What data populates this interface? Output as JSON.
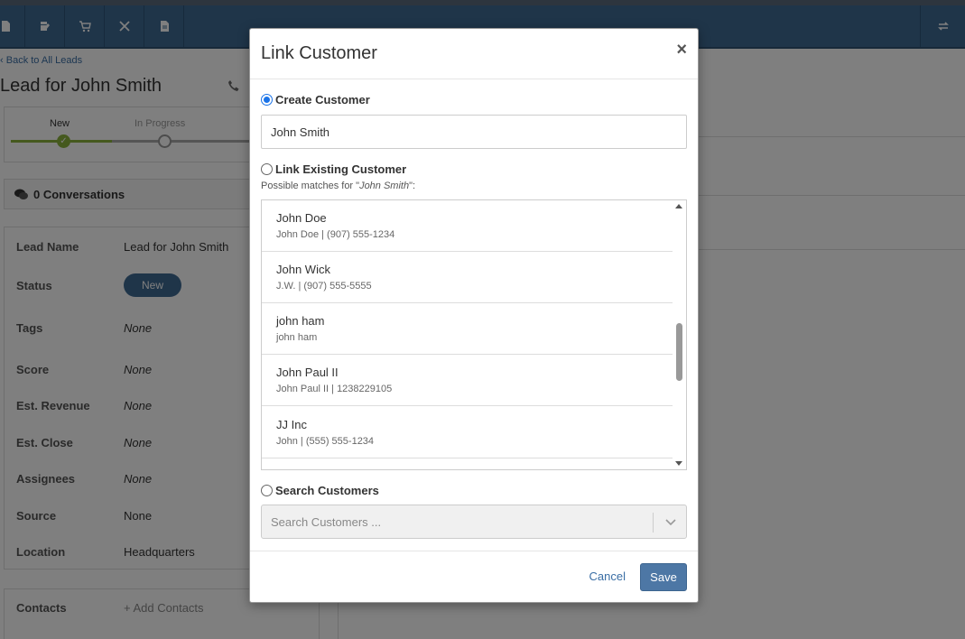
{
  "page": {
    "back_link": "Back to All Leads",
    "title": "Lead for John Smith",
    "stages": [
      "New",
      "In Progress"
    ],
    "conversations": "0 Conversations",
    "details": [
      {
        "label": "Lead Name",
        "value": "Lead for John Smith",
        "italic": false
      },
      {
        "label": "Status",
        "value": "New",
        "pill": true
      },
      {
        "label": "Tags",
        "value": "None",
        "italic": true
      },
      {
        "label": "Score",
        "value": "None",
        "italic": true
      },
      {
        "label": "Est. Revenue",
        "value": "None",
        "italic": true
      },
      {
        "label": "Est. Close",
        "value": "None",
        "italic": true
      },
      {
        "label": "Assignees",
        "value": "None",
        "italic": true
      },
      {
        "label": "Source",
        "value": "None",
        "italic": false
      },
      {
        "label": "Location",
        "value": "Headquarters",
        "italic": false
      }
    ],
    "contacts_label": "Contacts",
    "add_contacts": "Add Contacts"
  },
  "modal": {
    "title": "Link Customer",
    "close": "×",
    "create_label": "Create Customer",
    "create_value": "John Smith",
    "link_existing_label": "Link Existing Customer",
    "matches_prefix": "Possible matches for \"",
    "matches_name": "John Smith",
    "matches_suffix": "\":",
    "matches": [
      {
        "name": "John Doe",
        "sub": "John Doe | (907) 555-1234"
      },
      {
        "name": "John Wick",
        "sub": "J.W. | (907) 555-5555"
      },
      {
        "name": "john ham",
        "sub": "john ham"
      },
      {
        "name": "John Paul II",
        "sub": "John Paul II | 1238229105"
      },
      {
        "name": "JJ Inc",
        "sub": "John | (555) 555-1234"
      }
    ],
    "search_label": "Search Customers",
    "search_placeholder": "Search Customers ...",
    "cancel": "Cancel",
    "save": "Save"
  },
  "colors": {
    "toolbar": "#3e6a93",
    "accent": "#4d77a5",
    "success": "#8bb33c",
    "link": "#3a6ea5"
  }
}
